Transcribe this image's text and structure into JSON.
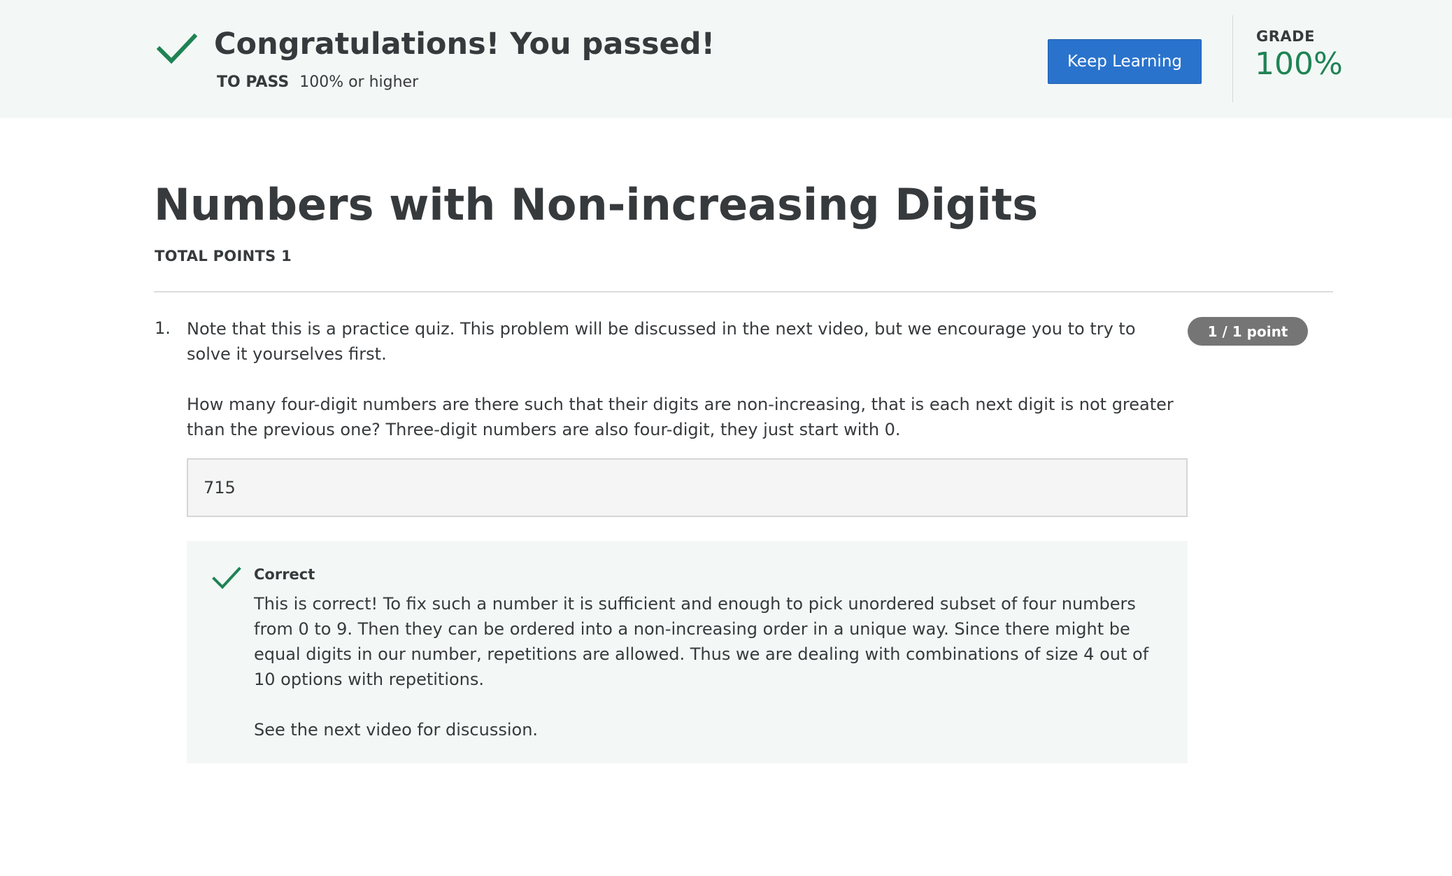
{
  "banner": {
    "check_icon": "checkmark-icon",
    "title": "Congratulations! You passed!",
    "pass_label": "TO PASS",
    "pass_value": "100% or higher",
    "keep_learning_label": "Keep Learning",
    "grade_label": "GRADE",
    "grade_value": "100%"
  },
  "quiz": {
    "title": "Numbers with Non-increasing Digits",
    "total_points": "TOTAL POINTS 1"
  },
  "question": {
    "number": "1.",
    "text_p1": "Note that this is a practice quiz. This problem will be discussed in the next video, but we encourage you to try to solve it yourselves first.",
    "text_p2": "How many four-digit numbers are there such that their digits are non-increasing, that is each next digit is not greater than the previous one? Three-digit numbers are also four-digit, they just start with 0.",
    "points_badge": "1 / 1 point",
    "answer_value": "715"
  },
  "feedback": {
    "check_icon": "checkmark-icon",
    "title": "Correct",
    "text_p1": "This is correct! To fix such a number it is sufficient and enough to pick unordered subset of four numbers from 0 to 9. Then they can be ordered into a non-increasing order in a unique way. Since there might be equal digits in our number, repetitions are allowed. Thus we are dealing with combinations of size 4 out of 10 options with repetitions.",
    "text_p2": "See the next video for discussion."
  },
  "colors": {
    "success_green": "#1f8354",
    "banner_bg": "#f3f8f6",
    "primary_blue": "#2a73cc",
    "badge_gray": "#757575"
  }
}
